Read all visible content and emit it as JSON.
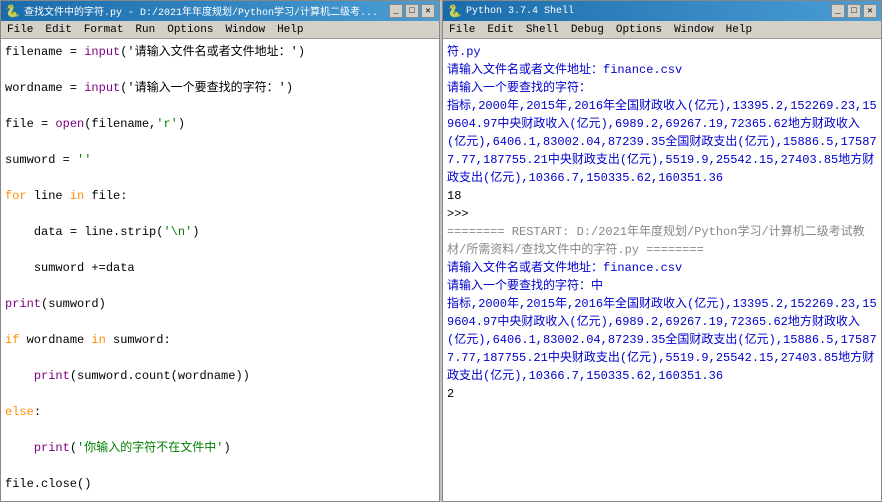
{
  "left_window": {
    "title": "查找文件中的字符.py - D:/2021年年度规划/Python学习/计算机二级考...",
    "icon": "🐍",
    "menu_items": [
      "File",
      "Edit",
      "Format",
      "Run",
      "Options",
      "Window",
      "Help"
    ],
    "controls": [
      "_",
      "□",
      "✕"
    ]
  },
  "right_window": {
    "title": "Python 3.7.4 Shell",
    "icon": "🐍",
    "menu_items": [
      "File",
      "Edit",
      "Shell",
      "Debug",
      "Options",
      "Window",
      "Help"
    ],
    "controls": [
      "_",
      "□",
      "✕"
    ]
  }
}
